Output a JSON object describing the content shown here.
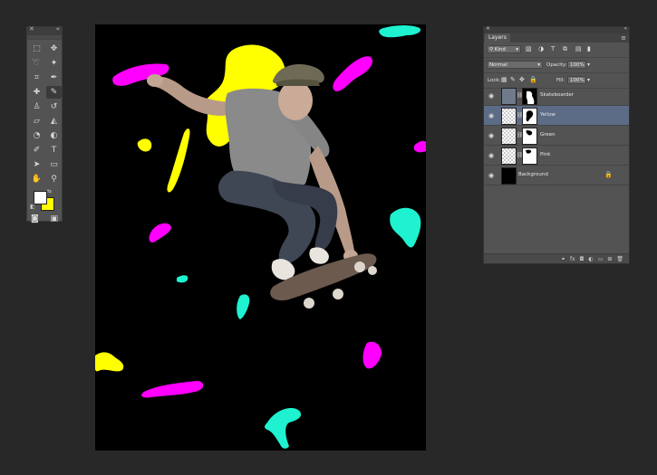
{
  "tools_panel": {
    "collapse_icon": "double-chevron-icon",
    "tools": [
      {
        "name": "marquee-tool-icon",
        "glyph": "⬚"
      },
      {
        "name": "move-tool-icon",
        "glyph": "✥"
      },
      {
        "name": "lasso-tool-icon",
        "glyph": "➰"
      },
      {
        "name": "magic-wand-icon",
        "glyph": "✦"
      },
      {
        "name": "crop-tool-icon",
        "glyph": "⌗"
      },
      {
        "name": "eyedropper-icon",
        "glyph": "✒"
      },
      {
        "name": "healing-brush-icon",
        "glyph": "✚"
      },
      {
        "name": "brush-tool-icon",
        "glyph": "✎"
      },
      {
        "name": "clone-stamp-icon",
        "glyph": "♙"
      },
      {
        "name": "history-brush-icon",
        "glyph": "↺"
      },
      {
        "name": "eraser-tool-icon",
        "glyph": "▱"
      },
      {
        "name": "paint-bucket-icon",
        "glyph": "◭"
      },
      {
        "name": "blur-tool-icon",
        "glyph": "◔"
      },
      {
        "name": "dodge-tool-icon",
        "glyph": "◐"
      },
      {
        "name": "pen-tool-icon",
        "glyph": "✐"
      },
      {
        "name": "type-tool-icon",
        "glyph": "T"
      },
      {
        "name": "path-selection-icon",
        "glyph": "➤"
      },
      {
        "name": "rectangle-tool-icon",
        "glyph": "▭"
      },
      {
        "name": "hand-tool-icon",
        "glyph": "✋"
      },
      {
        "name": "zoom-tool-icon",
        "glyph": "⚲"
      }
    ],
    "foreground_color": "#ffffff",
    "background_color": "#ffff00",
    "quick_mask_icon": "quick-mask-icon",
    "screen_mode_icon": "screen-mode-icon"
  },
  "layers_panel": {
    "tab_label": "Layers",
    "filter_kind": "Kind",
    "blend_mode": "Normal",
    "opacity_label": "Opacity:",
    "opacity_value": "100%",
    "lock_label": "Lock:",
    "fill_label": "Fill:",
    "fill_value": "100%",
    "layers": [
      {
        "name": "Skateboarder",
        "selected": false
      },
      {
        "name": "Yellow",
        "selected": true
      },
      {
        "name": "Green",
        "selected": false
      },
      {
        "name": "Pink",
        "selected": false
      },
      {
        "name": "Background",
        "selected": false
      }
    ],
    "footer_icons": [
      "link-layers-icon",
      "fx-icon",
      "add-mask-icon",
      "adjustment-layer-icon",
      "new-group-icon",
      "new-layer-icon",
      "delete-layer-icon"
    ]
  },
  "canvas": {
    "background_color": "#000000",
    "splash_colors": {
      "pink": "#ff00ff",
      "yellow": "#ffff00",
      "green": "#1ef2d0"
    }
  }
}
